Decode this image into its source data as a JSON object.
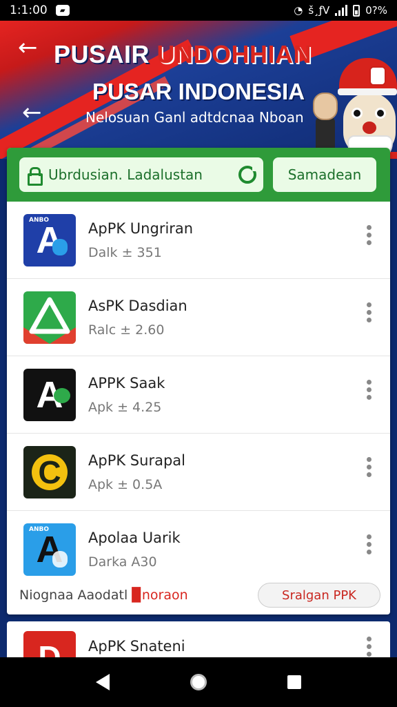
{
  "status_bar": {
    "time": "1:1:00",
    "network_text": "š¸ƒV",
    "battery_text": "0?%"
  },
  "banner": {
    "title_line1_white": "PUSAIR",
    "title_line1_red": "UNDOHHIAN",
    "title_line2": "PUSAR INDONESIA",
    "subtitle": "Nelosuan Ganl adtdcnaa Nboan"
  },
  "search": {
    "value": "Ubrdusian. Ladalustan",
    "button_label": "Samadean"
  },
  "apps": [
    {
      "name": "ApPK Ungriran",
      "sub": "Dalk ± 351",
      "icon": "app-icon-a-blue",
      "icon_bg": "#1f3fa8",
      "tiny": "ANBO"
    },
    {
      "name": "AsPK Dasdian",
      "sub": "Ralc ± 2.60",
      "icon": "app-icon-triangle-green",
      "icon_bg": "#2eaa4a",
      "tiny": ""
    },
    {
      "name": "APPK Saak",
      "sub": "Apk ± 4.25",
      "icon": "app-icon-a-black",
      "icon_bg": "#111111",
      "tiny": ""
    },
    {
      "name": "ApPK Surapal",
      "sub": "Apk ± 0.5A",
      "icon": "app-icon-c-yellow",
      "icon_bg": "#1b2418",
      "tiny": ""
    },
    {
      "name": "Apolaa Uarik",
      "sub": "Darka A30",
      "icon": "app-icon-a-lightblue",
      "icon_bg": "#2a9ee8",
      "tiny": "ANBO"
    }
  ],
  "footer": {
    "text": "Niognaa Aaodatl ",
    "highlight": "▉noraon",
    "button_label": "Sralgan PPK"
  },
  "next_app": {
    "name": "ApPK Snateni",
    "icon": "app-icon-d-red",
    "icon_bg": "#d8261f"
  },
  "colors": {
    "green_bar": "#2f9b3a",
    "red_accent": "#d8261f",
    "banner_blue": "#102b73"
  }
}
